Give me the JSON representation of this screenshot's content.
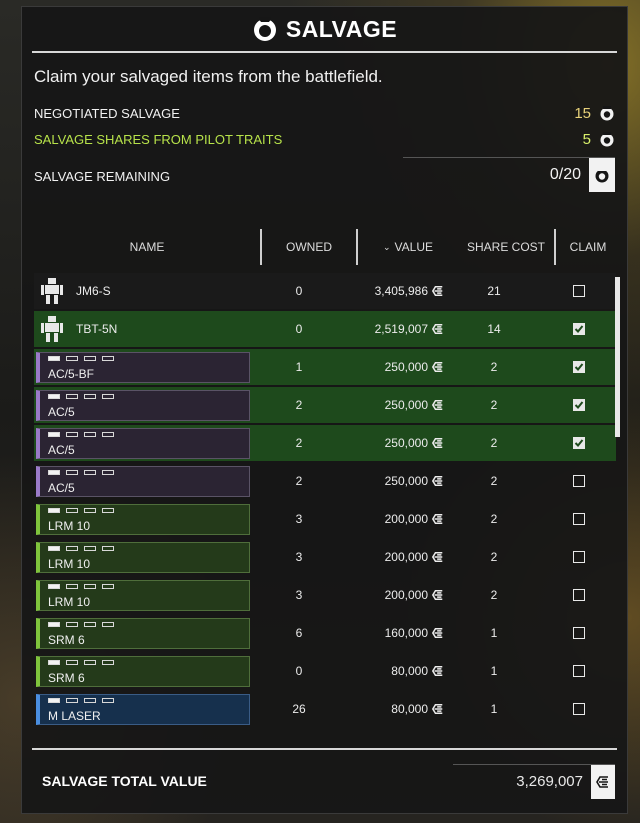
{
  "header": {
    "title": "SALVAGE",
    "icon": "salvage-logo-icon"
  },
  "subtitle": "Claim your salvaged items from the battlefield.",
  "stats": {
    "negotiated_label": "NEGOTIATED SALVAGE",
    "negotiated_value": "15",
    "pilot_label": "SALVAGE SHARES FROM PILOT TRAITS",
    "pilot_value": "5",
    "remaining_label": "SALVAGE REMAINING",
    "remaining_value": "0/20"
  },
  "table": {
    "columns": {
      "name": "NAME",
      "owned": "OWNED",
      "value": "VALUE",
      "share_cost": "SHARE COST",
      "claim": "CLAIM"
    },
    "rows": [
      {
        "kind": "mech",
        "name": "JM6-S",
        "owned": "0",
        "value": "3,405,986",
        "share": "21",
        "claimed": false
      },
      {
        "kind": "mech",
        "name": "TBT-5N",
        "owned": "0",
        "value": "2,519,007",
        "share": "14",
        "claimed": true
      },
      {
        "kind": "ballistic",
        "name": "AC/5-BF",
        "owned": "1",
        "value": "250,000",
        "share": "2",
        "claimed": true,
        "pips": 1
      },
      {
        "kind": "ballistic",
        "name": "AC/5",
        "owned": "2",
        "value": "250,000",
        "share": "2",
        "claimed": true,
        "pips": 1
      },
      {
        "kind": "ballistic",
        "name": "AC/5",
        "owned": "2",
        "value": "250,000",
        "share": "2",
        "claimed": true,
        "pips": 1
      },
      {
        "kind": "ballistic",
        "name": "AC/5",
        "owned": "2",
        "value": "250,000",
        "share": "2",
        "claimed": false,
        "pips": 1
      },
      {
        "kind": "missile",
        "name": "LRM 10",
        "owned": "3",
        "value": "200,000",
        "share": "2",
        "claimed": false,
        "pips": 1
      },
      {
        "kind": "missile",
        "name": "LRM 10",
        "owned": "3",
        "value": "200,000",
        "share": "2",
        "claimed": false,
        "pips": 1
      },
      {
        "kind": "missile",
        "name": "LRM 10",
        "owned": "3",
        "value": "200,000",
        "share": "2",
        "claimed": false,
        "pips": 1
      },
      {
        "kind": "missile",
        "name": "SRM 6",
        "owned": "6",
        "value": "160,000",
        "share": "1",
        "claimed": false,
        "pips": 1
      },
      {
        "kind": "missile",
        "name": "SRM 6",
        "owned": "0",
        "value": "80,000",
        "share": "1",
        "claimed": false,
        "pips": 1
      },
      {
        "kind": "energy",
        "name": "M LASER",
        "owned": "26",
        "value": "80,000",
        "share": "1",
        "claimed": false,
        "pips": 1
      }
    ]
  },
  "total": {
    "label": "SALVAGE TOTAL VALUE",
    "value": "3,269,007"
  },
  "colors": {
    "selected_row": "#1e4a1c",
    "pilot_traits": "#b7e24a",
    "ballistic_accent": "#9a7ac8",
    "missile_accent": "#7fc43c",
    "energy_accent": "#4a8ee0"
  }
}
